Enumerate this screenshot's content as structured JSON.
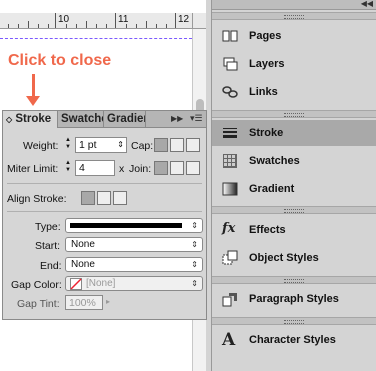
{
  "ruler": {
    "ticks_labels": [
      "10",
      "11",
      "12"
    ]
  },
  "callout": {
    "text": "Click to close"
  },
  "stroke_panel": {
    "tabs": [
      "Stroke",
      "Swatches",
      "Gradient"
    ],
    "menu_icon": "panel-menu-icon",
    "weight_label": "Weight:",
    "weight_value": "1 pt",
    "cap_label": "Cap:",
    "miter_label": "Miter Limit:",
    "miter_value": "4",
    "miter_x": "x",
    "join_label": "Join:",
    "align_label": "Align Stroke:",
    "type_label": "Type:",
    "start_label": "Start:",
    "start_value": "None",
    "end_label": "End:",
    "end_value": "None",
    "gap_color_label": "Gap Color:",
    "gap_color_value": "[None]",
    "gap_tint_label": "Gap Tint:",
    "gap_tint_value": "100%"
  },
  "right_panels": {
    "group1": [
      {
        "label": "Pages",
        "icon": "pages-icon"
      },
      {
        "label": "Layers",
        "icon": "layers-icon"
      },
      {
        "label": "Links",
        "icon": "links-icon"
      }
    ],
    "group2": [
      {
        "label": "Stroke",
        "icon": "stroke-icon",
        "selected": true
      },
      {
        "label": "Swatches",
        "icon": "swatches-icon"
      },
      {
        "label": "Gradient",
        "icon": "gradient-icon"
      }
    ],
    "group3": [
      {
        "label": "Effects",
        "icon": "fx-icon",
        "glyph": "fx"
      },
      {
        "label": "Object Styles",
        "icon": "object-styles-icon"
      }
    ],
    "group4": [
      {
        "label": "Paragraph Styles",
        "icon": "paragraph-styles-icon"
      }
    ],
    "group5": [
      {
        "label": "Character Styles",
        "icon": "character-styles-icon",
        "glyph": "A"
      }
    ]
  },
  "colors": {
    "accent": "#f0684b",
    "selected_row": "#a9a9a9"
  }
}
